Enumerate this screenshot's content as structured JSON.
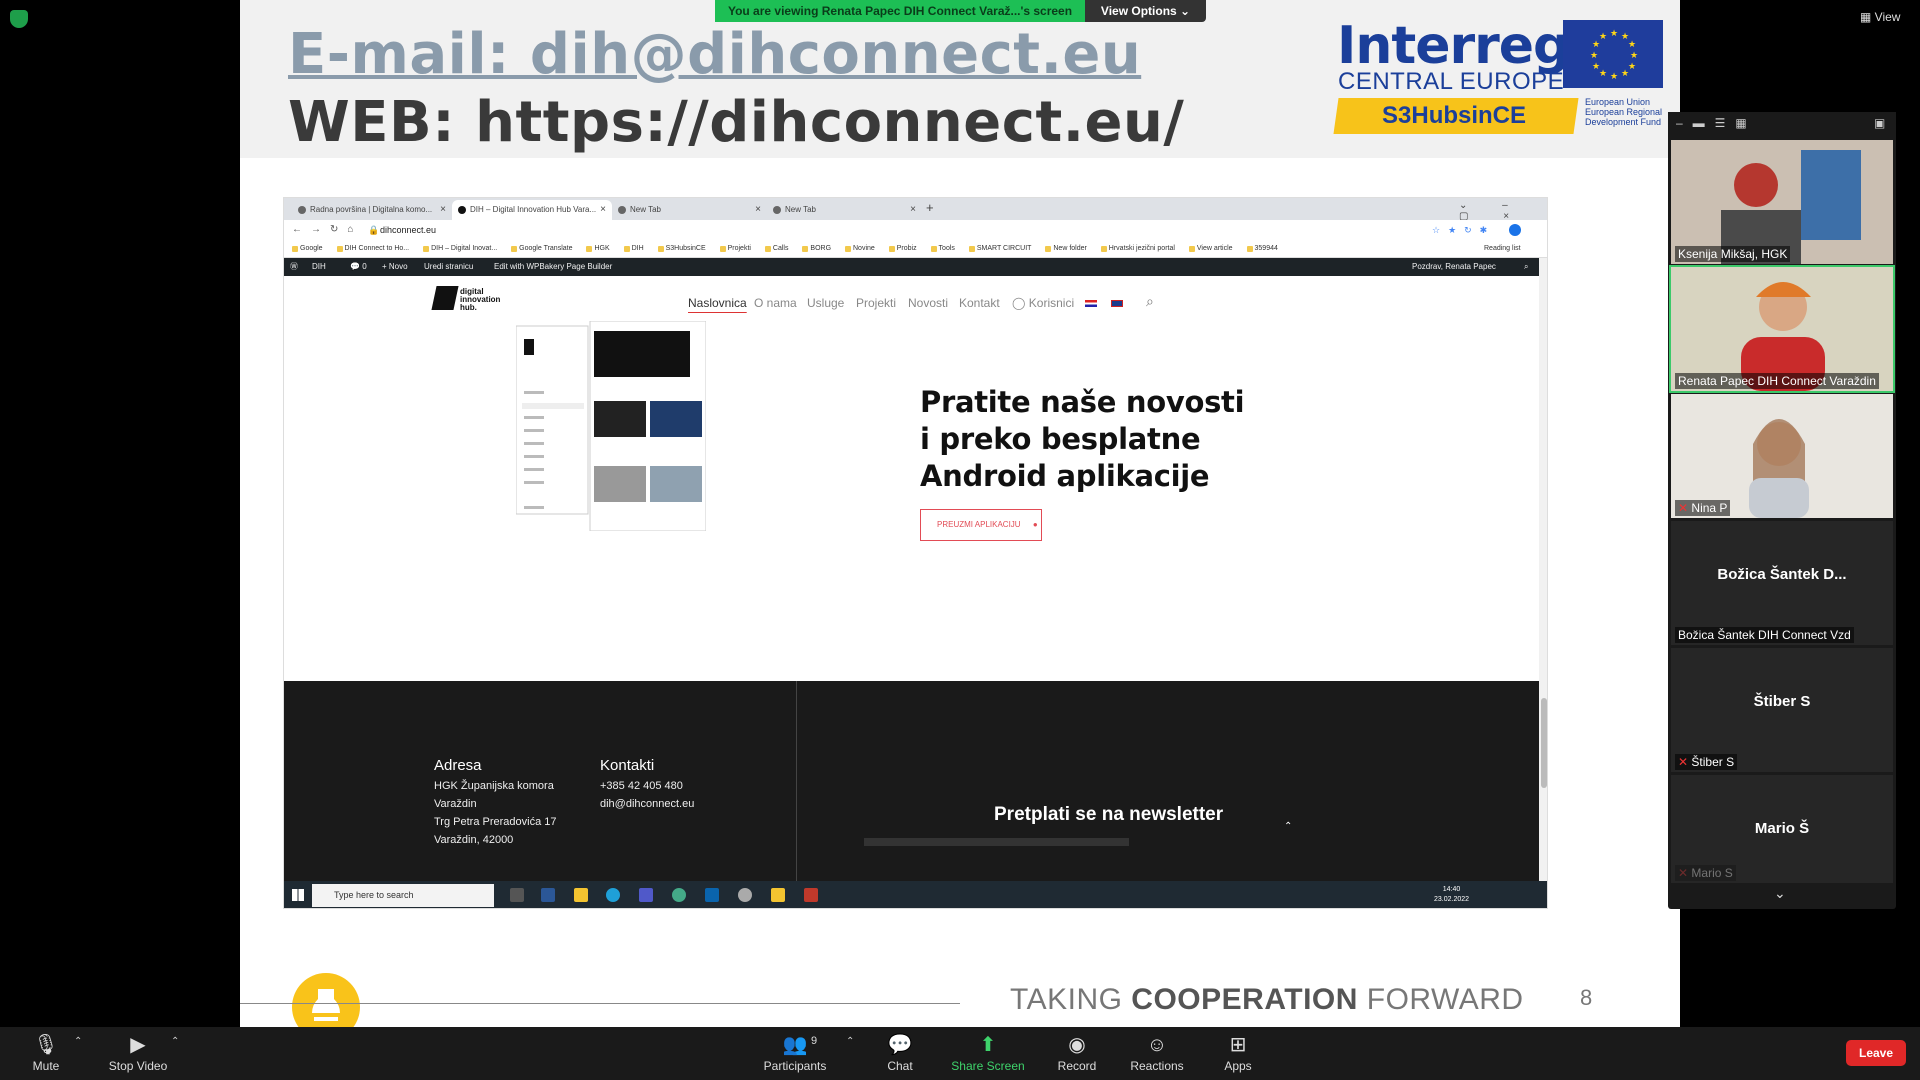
{
  "slide": {
    "email": "E-mail: dih@dihconnect.eu",
    "web": "WEB: https://dihconnect.eu/",
    "logo_interreg": "Interreg",
    "logo_central": "CENTRAL EUROPE",
    "logo_s3": "S3HubsinCE",
    "logo_eu": "European Union European Regional Development Fund",
    "tagline_pre": "TAKING ",
    "tagline_bold": "COOPERATION",
    "tagline_post": " FORWARD",
    "page_number": "8"
  },
  "share": {
    "banner": "You are viewing Renata Papec DIH Connect Varaž...'s screen",
    "view_options": "View Options ⌄"
  },
  "browser": {
    "tabs": [
      {
        "label": "Radna površina | Digitalna komo..."
      },
      {
        "label": "DIH – Digital Innovation Hub Vara..."
      },
      {
        "label": "New Tab"
      },
      {
        "label": "New Tab"
      }
    ],
    "address": "dihconnect.eu",
    "bookmarks": [
      "Google",
      "DIH Connect to Ho...",
      "DIH – Digital Inovat...",
      "Google Translate",
      "HGK",
      "DIH",
      "S3HubsinCE",
      "Projekti",
      "Calls",
      "BORG",
      "Novine",
      "Probiz",
      "Tools",
      "SMART CIRCUIT",
      "New folder",
      "Hrvatski jezični portal",
      "View article",
      "359944"
    ],
    "reading_list": "Reading list",
    "wp_items": [
      "DIH",
      "0",
      "+ Novo",
      "Uredi stranicu",
      "Edit with WPBakery Page Builder"
    ],
    "wp_greeting": "Pozdrav, Renata Papec",
    "nav": [
      "Naslovnica",
      "O nama",
      "Usluge",
      "Projekti",
      "Novosti",
      "Kontakt",
      "Korisnici"
    ],
    "site_logo": "digital innovation hub.",
    "heading": "Pratite naše novosti\ni preko besplatne\nAndroid aplikacije",
    "download_btn": "PREUZMI APLIKACIJU",
    "footer": {
      "address_title": "Adresa",
      "address": "HGK Županijska komora\nVaraždin\nTrg Petra Preradovića 17\nVaraždin, 42000",
      "contacts_title": "Kontakti",
      "contacts": "+385 42 405 480\ndih@dihconnect.eu",
      "newsletter": "Pretplati se na newsletter"
    },
    "taskbar_search": "Type here to search",
    "clock_time": "14:40",
    "clock_date": "23.02.2022"
  },
  "gallery": {
    "participants": [
      {
        "name": "Ksenija Mikšaj, HGK",
        "video": true
      },
      {
        "name": "Renata Papec DIH Connect Varaždin",
        "video": true
      },
      {
        "name": "Nina P",
        "video": true,
        "muted": true
      },
      {
        "name": "Božica Šantek DIH Connect Vzd",
        "display": "Božica Šantek D...",
        "video": false
      },
      {
        "name": "Štiber S",
        "display": "Štiber S",
        "video": false,
        "muted": true
      },
      {
        "name": "Mario S",
        "display": "Mario Š",
        "video": false,
        "muted": true
      }
    ]
  },
  "zoom": {
    "view": "View",
    "mute": "Mute",
    "stop_video": "Stop Video",
    "participants": "Participants",
    "participants_count": "9",
    "chat": "Chat",
    "share_screen": "Share Screen",
    "record": "Record",
    "reactions": "Reactions",
    "apps": "Apps",
    "leave": "Leave"
  },
  "colors": {
    "share_green": "#1dbf55",
    "leave_red": "#e02828",
    "interreg_blue": "#1b3f9a",
    "interreg_yellow": "#f7c31a"
  }
}
